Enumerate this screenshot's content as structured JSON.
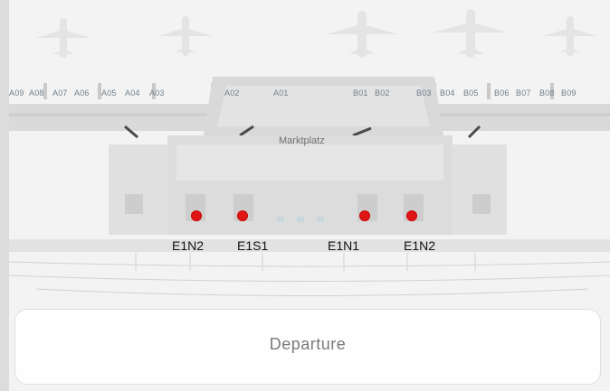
{
  "map": {
    "gates": [
      "A09",
      "A08",
      "A07",
      "A06",
      "A05",
      "A04",
      "A03",
      "A02",
      "A01",
      "B01",
      "B02",
      "B03",
      "B04",
      "B05",
      "B06",
      "B07",
      "B08",
      "B09"
    ],
    "plaza_label": "Marktplatz",
    "colors": {
      "marker": "#e01616",
      "building": "#d8d8d8",
      "background": "#f3f3f3"
    }
  },
  "markers": [
    {
      "label": "E1N2"
    },
    {
      "label": "E1S1"
    },
    {
      "label": "E1N1"
    },
    {
      "label": "E1N2"
    }
  ],
  "footer": {
    "label": "Departure"
  }
}
